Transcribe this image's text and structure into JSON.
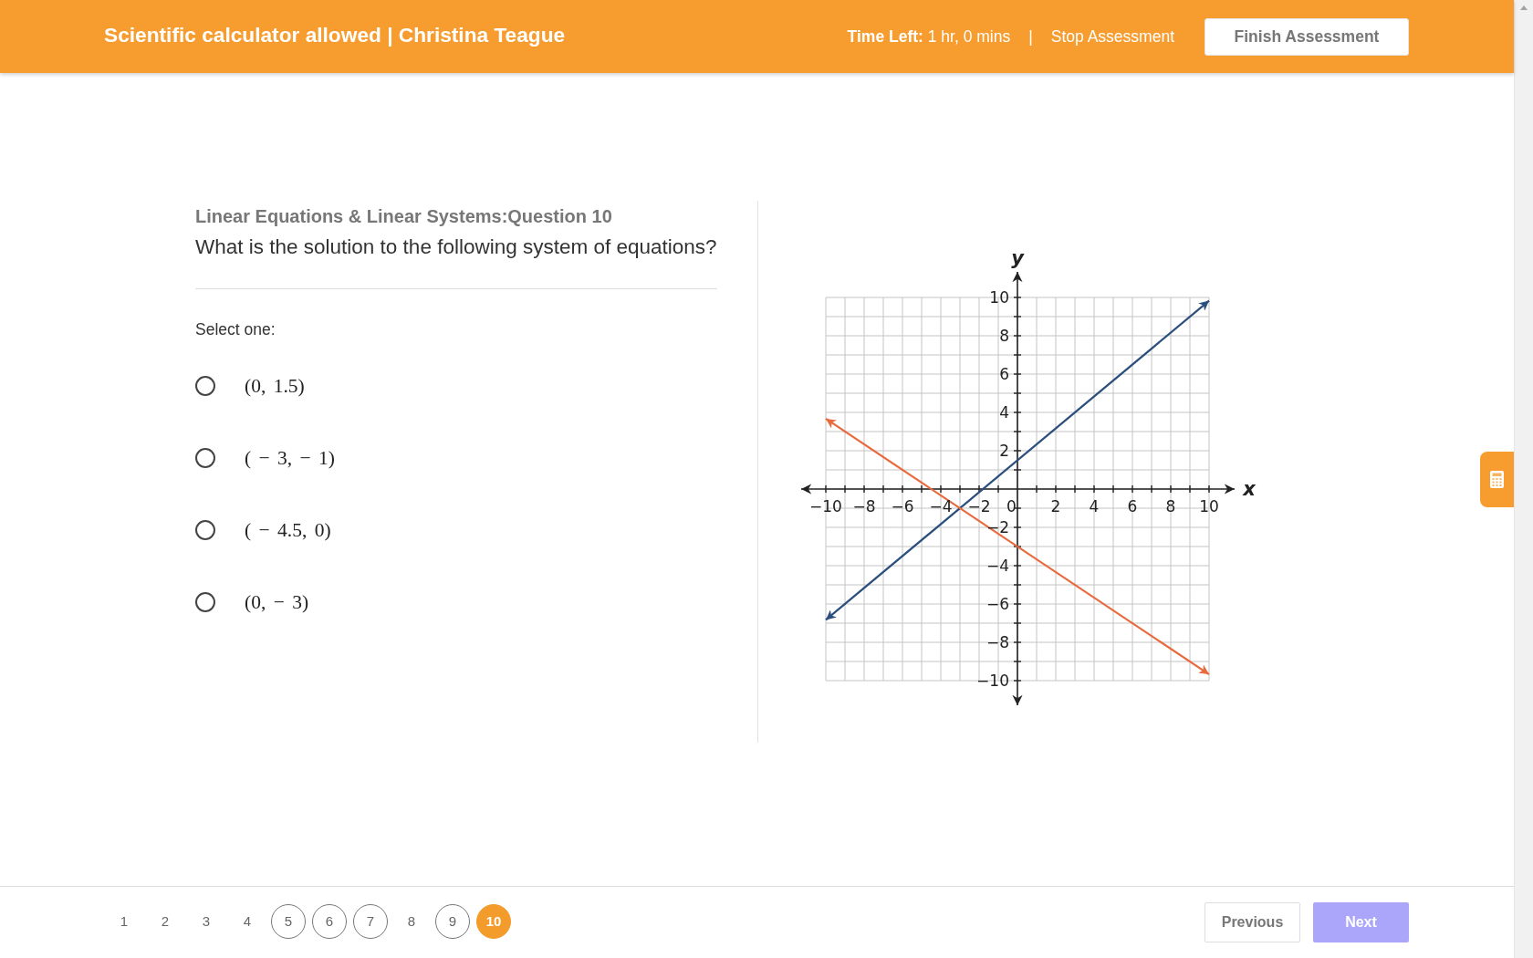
{
  "header": {
    "title": "Scientific calculator allowed | Christina Teague",
    "timer": "**Time Left:** 1 hr, 0 mins",
    "separator": "|",
    "stop_link": "Stop Assessment",
    "finish_button": "Finish Assessment"
  },
  "question": {
    "category": "Linear Equations & Linear Systems:Question 10",
    "prompt": "What is the solution to the following system of equations?",
    "instruction": "Select one:",
    "options": [
      {
        "text": "(0, 1.5)",
        "selected": false
      },
      {
        "text": "( − 3, − 1)",
        "selected": false
      },
      {
        "text": "( − 4.5, 0)",
        "selected": false
      },
      {
        "text": "(0, − 3)",
        "selected": false
      }
    ],
    "chart_data": {
      "type": "line",
      "xlabel": "x",
      "ylabel": "y",
      "grid": true,
      "x": [
        -10,
        10
      ],
      "series": [
        {
          "color": "#2a4e7d",
          "values": [
            -6.83,
            9.83
          ]
        },
        {
          "color": "#e8693b",
          "values": [
            3.67,
            -9.67
          ]
        }
      ],
      "xlim": [
        -10,
        10
      ],
      "ylim": [
        -10,
        10
      ],
      "xticks": [
        {
          "value": -10,
          "label": "−10"
        },
        {
          "value": -8,
          "label": "−8"
        },
        {
          "value": -6,
          "label": "−6"
        },
        {
          "value": -4,
          "label": "−4"
        },
        {
          "value": -2,
          "label": "−2"
        },
        {
          "value": 0,
          "label": "0"
        },
        {
          "value": 2,
          "label": "2"
        },
        {
          "value": 4,
          "label": "4"
        },
        {
          "value": 6,
          "label": "6"
        },
        {
          "value": 8,
          "label": "8"
        },
        {
          "value": 10,
          "label": "10"
        }
      ],
      "yticks": [
        {
          "value": 10,
          "label": "10"
        },
        {
          "value": 8,
          "label": "8"
        },
        {
          "value": 6,
          "label": "6"
        },
        {
          "value": 4,
          "label": "4"
        },
        {
          "value": 2,
          "label": "2"
        },
        {
          "value": -2,
          "label": "−2"
        },
        {
          "value": -4,
          "label": "−4"
        },
        {
          "value": -6,
          "label": "−6"
        },
        {
          "value": -8,
          "label": "−8"
        },
        {
          "value": -10,
          "label": "−10"
        }
      ]
    }
  },
  "pagination": {
    "pages": [
      {
        "label": "1",
        "answered": false,
        "selected": false
      },
      {
        "label": "2",
        "answered": false,
        "selected": false
      },
      {
        "label": "3",
        "answered": false,
        "selected": false
      },
      {
        "label": "4",
        "answered": false,
        "selected": false
      },
      {
        "label": "5",
        "answered": true,
        "selected": false
      },
      {
        "label": "6",
        "answered": true,
        "selected": false
      },
      {
        "label": "7",
        "answered": true,
        "selected": false
      },
      {
        "label": "8",
        "answered": false,
        "selected": false
      },
      {
        "label": "9",
        "answered": true,
        "selected": false
      },
      {
        "label": "10",
        "answered": false,
        "selected": true
      }
    ],
    "previous_button": {
      "label": "Previous",
      "disabled": false
    },
    "next_button": {
      "label": "Next",
      "disabled": true
    }
  }
}
